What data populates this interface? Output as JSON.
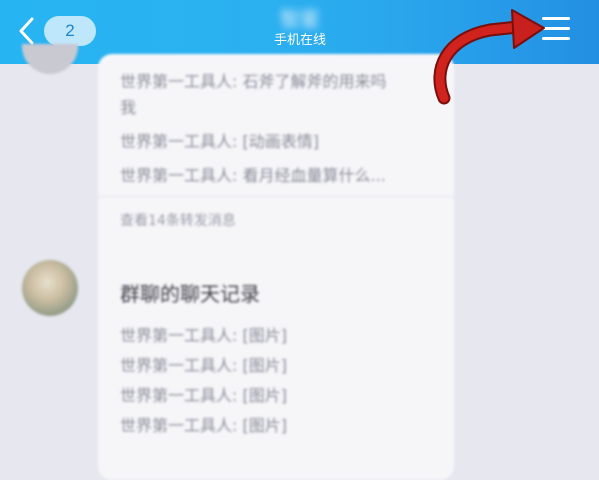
{
  "header": {
    "back_count": "2",
    "contact_name": "智星",
    "contact_status": "手机在线"
  },
  "chat": {
    "forward_card": {
      "lines": [
        "世界第一工具人: 石斧了解斧的用来吗",
        "我",
        "世界第一工具人: [动画表情]",
        "世界第一工具人: 看月经血量算什么..."
      ],
      "more_link": "查看14条转发消息"
    },
    "record_card": {
      "title": "群聊的聊天记录",
      "lines": [
        "世界第一工具人: [图片]",
        "世界第一工具人: [图片]",
        "世界第一工具人: [图片]",
        "世界第一工具人: [图片]"
      ]
    }
  },
  "colors": {
    "header_start": "#27b4f2",
    "header_end": "#238fe2",
    "chat_background": "#e6e7ef",
    "bubble_background": "#f6f6f9",
    "annotation_arrow": "#c8201c"
  },
  "icons": {
    "back": "chevron-left-icon",
    "menu": "hamburger-menu-icon",
    "annotation": "curved-arrow-icon"
  }
}
